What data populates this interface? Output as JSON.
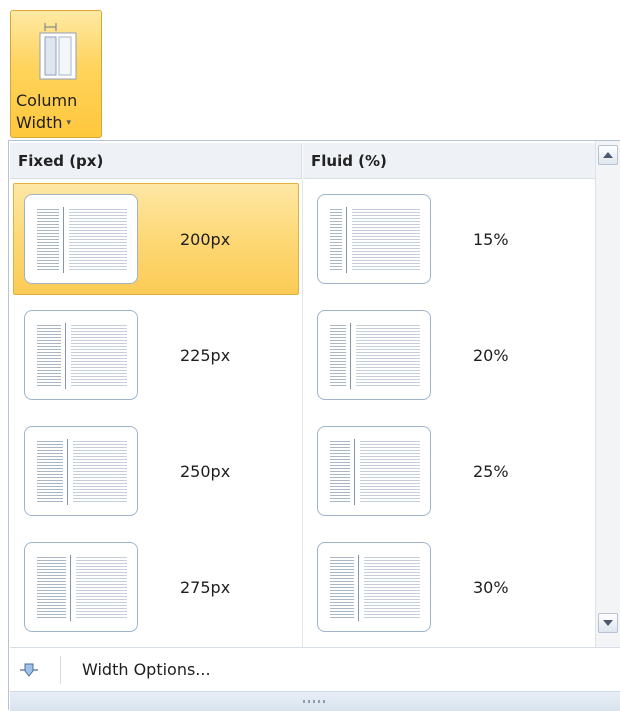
{
  "ribbon": {
    "button_label_line1": "Column",
    "button_label_line2": "Width",
    "caret": "▾",
    "icon": "column-width-icon"
  },
  "gallery": {
    "fixed_header": "Fixed (px)",
    "fluid_header": "Fluid (%)",
    "fixed_items": [
      {
        "label": "200px",
        "selected": true
      },
      {
        "label": "225px",
        "selected": false
      },
      {
        "label": "250px",
        "selected": false
      },
      {
        "label": "275px",
        "selected": false
      }
    ],
    "fluid_items": [
      {
        "label": "15%",
        "selected": false
      },
      {
        "label": "20%",
        "selected": false
      },
      {
        "label": "25%",
        "selected": false
      },
      {
        "label": "30%",
        "selected": false
      }
    ]
  },
  "footer": {
    "options_label": "Width Options...",
    "icon": "width-options-icon"
  },
  "colors": {
    "selected_fill": "#fdd876",
    "selected_border": "#e2b13c",
    "thumb_border": "#9fb4cc"
  }
}
